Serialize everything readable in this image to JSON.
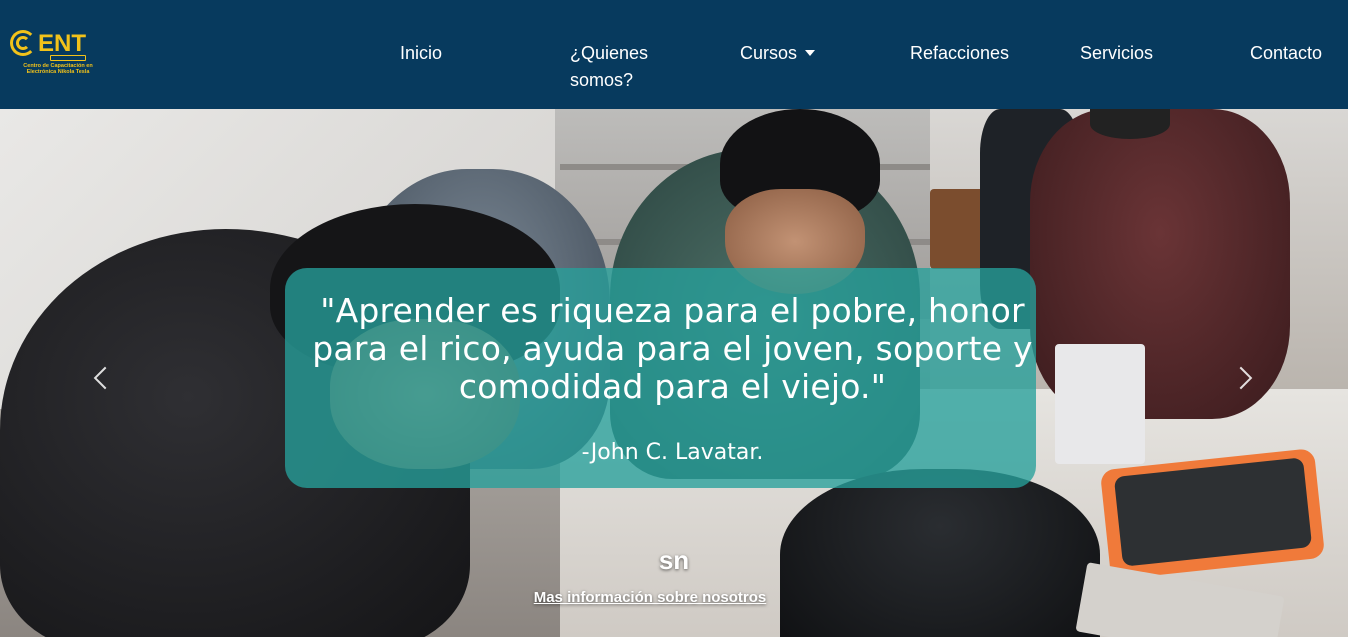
{
  "logo": {
    "brand": "ENT",
    "tagline": "Centro de Capacitación en Electrónica Nikola Tesla"
  },
  "nav": {
    "items": [
      {
        "label": "Inicio"
      },
      {
        "label": "¿Quienes somos?"
      },
      {
        "label": "Cursos",
        "dropdown": true
      },
      {
        "label": "Refacciones"
      },
      {
        "label": "Servicios"
      },
      {
        "label": "Contacto"
      }
    ]
  },
  "carousel": {
    "quote": "\"Aprender es riqueza para el pobre, honor para el rico, ayuda para el joven, soporte y comodidad para el viejo.\"",
    "author": "-John C. Lavatar.",
    "slide_title": "sn",
    "link_label": "Mas información sobre nosotros"
  },
  "colors": {
    "navbar": "#073a5e",
    "logo": "#f2c21a",
    "caption_box": "#26a09b"
  }
}
